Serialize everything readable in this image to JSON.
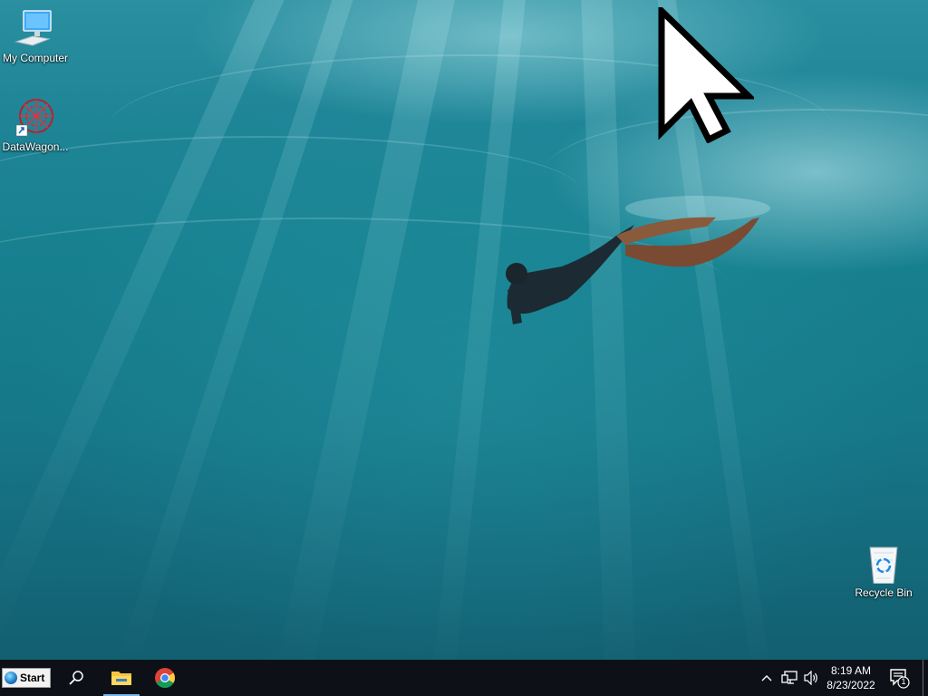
{
  "desktop": {
    "icons": [
      {
        "label": "My Computer",
        "icon": "computer-icon"
      },
      {
        "label": "DataWagon...",
        "icon": "datawagon-icon"
      },
      {
        "label": "Recycle Bin",
        "icon": "recycle-bin-icon"
      }
    ],
    "wallpaper": "underwater-swimmer",
    "colors": {
      "water_top": "#2a8fa0",
      "water_bottom": "#125f70"
    }
  },
  "taskbar": {
    "start_label": "Start",
    "pinned": [
      {
        "name": "search",
        "icon": "search-icon"
      },
      {
        "name": "file-explorer",
        "icon": "folder-icon",
        "active": true
      },
      {
        "name": "chrome",
        "icon": "chrome-icon"
      }
    ],
    "tray": {
      "time": "8:19 AM",
      "date": "8/23/2022",
      "notification_count": "1"
    },
    "colors": {
      "background": "#0d1117",
      "active_indicator": "#76b9ed"
    }
  }
}
